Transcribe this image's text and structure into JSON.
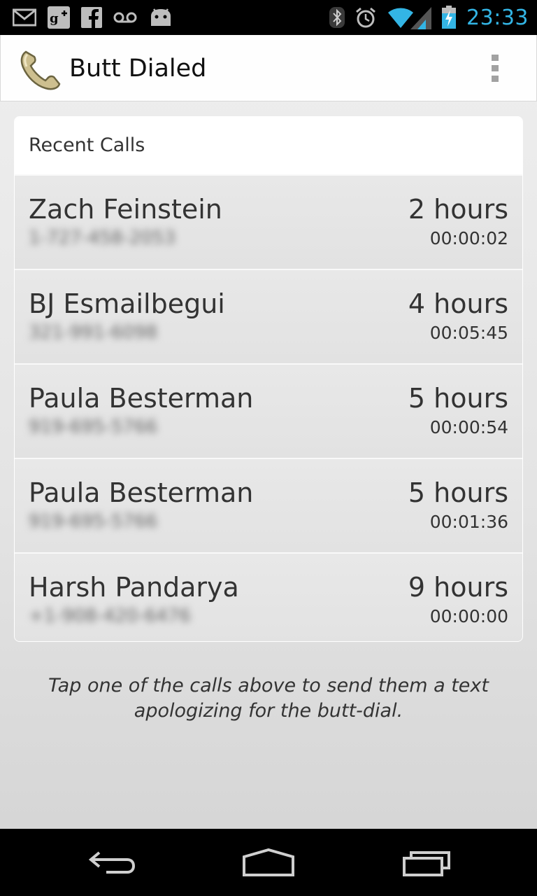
{
  "status_bar": {
    "time": "23:33",
    "left_icons": [
      "gmail-icon",
      "google-plus-icon",
      "facebook-icon",
      "voicemail-icon",
      "android-icon"
    ],
    "right_icons": [
      "bluetooth-icon",
      "alarm-icon",
      "wifi-icon",
      "signal-icon",
      "battery-charging-icon"
    ],
    "accent_color": "#33b5e5"
  },
  "action_bar": {
    "title": "Butt Dialed",
    "app_icon": "phone-handset-icon",
    "overflow_icon": "overflow-menu-icon"
  },
  "recent_calls": {
    "title": "Recent Calls",
    "calls": [
      {
        "name": "Zach Feinstein",
        "number": "1-727-458-2053",
        "ago": "2 hours",
        "duration": "00:00:02"
      },
      {
        "name": "BJ Esmailbegui",
        "number": "321-991-6098",
        "ago": "4 hours",
        "duration": "00:05:45"
      },
      {
        "name": "Paula Besterman",
        "number": "919-695-5766",
        "ago": "5 hours",
        "duration": "00:00:54"
      },
      {
        "name": "Paula Besterman",
        "number": "919-695-5766",
        "ago": "5 hours",
        "duration": "00:01:36"
      },
      {
        "name": "Harsh Pandarya",
        "number": "+1-908-420-6476",
        "ago": "9 hours",
        "duration": "00:00:00"
      }
    ]
  },
  "hint": "Tap one of the calls above to send them a text apologizing for the butt-dial.",
  "nav_bar": {
    "buttons": [
      "back-icon",
      "home-icon",
      "recent-apps-icon"
    ]
  }
}
